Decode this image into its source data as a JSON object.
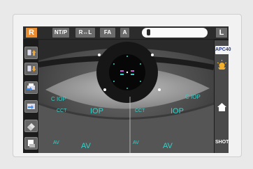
{
  "topbar": {
    "eye_right_label": "R",
    "ntp_label": "NT/P",
    "rl_label": "R↔L",
    "fa_label": "FA",
    "a_label": "A",
    "eye_left_label": "L"
  },
  "right_panel": {
    "apc_label": "APC40",
    "shot_label": "SHOT"
  },
  "overlay": {
    "left": {
      "cior": "C IOP",
      "cct": "CCT",
      "iop": "IOP",
      "av_small": "AV",
      "av_big": "AV"
    },
    "right": {
      "cior": "C IOP",
      "cct": "CCT",
      "iop": "IOP",
      "av_small": "AV",
      "av_big": "AV"
    }
  },
  "colors": {
    "accent_orange": "#e98b2f",
    "overlay_cyan": "#39d0c9",
    "button_gray": "#6b6b6b"
  }
}
